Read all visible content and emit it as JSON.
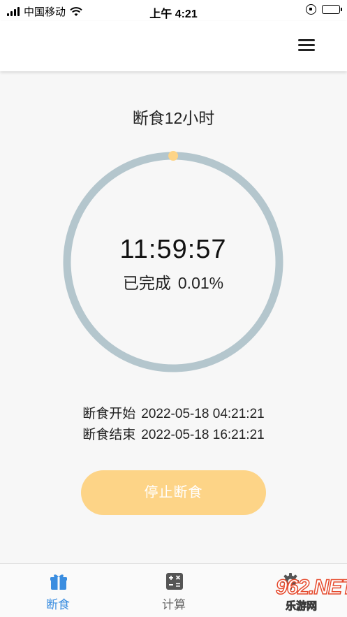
{
  "status_bar": {
    "carrier": "中国移动",
    "time": "上午 4:21",
    "icons": [
      "signal-icon",
      "wifi-icon",
      "orientation-lock-icon",
      "battery-icon"
    ]
  },
  "header": {
    "menu_icon": "hamburger-menu-icon"
  },
  "main": {
    "plan_title": "断食12小时",
    "timer": "11:59:57",
    "progress_label": "已完成",
    "progress_percent": "0.01%",
    "progress_fraction": 0.0001,
    "start_label": "断食开始",
    "start_time": "2022-05-18 04:21:21",
    "end_label": "断食结束",
    "end_time": "2022-05-18 16:21:21",
    "stop_button_label": "停止断食"
  },
  "colors": {
    "ring_track": "#b4c6cd",
    "ring_marker": "#fdd487",
    "button_bg": "#fdd487",
    "tab_active": "#3a8de0",
    "tab_inactive": "#666666"
  },
  "tabs": [
    {
      "label": "断食",
      "icon": "gift-icon",
      "active": true
    },
    {
      "label": "计算",
      "icon": "calculator-icon",
      "active": false
    },
    {
      "label": "",
      "icon": "gear-icon",
      "active": false
    }
  ],
  "watermark": {
    "main": "962.NET",
    "sub": "乐游网"
  }
}
